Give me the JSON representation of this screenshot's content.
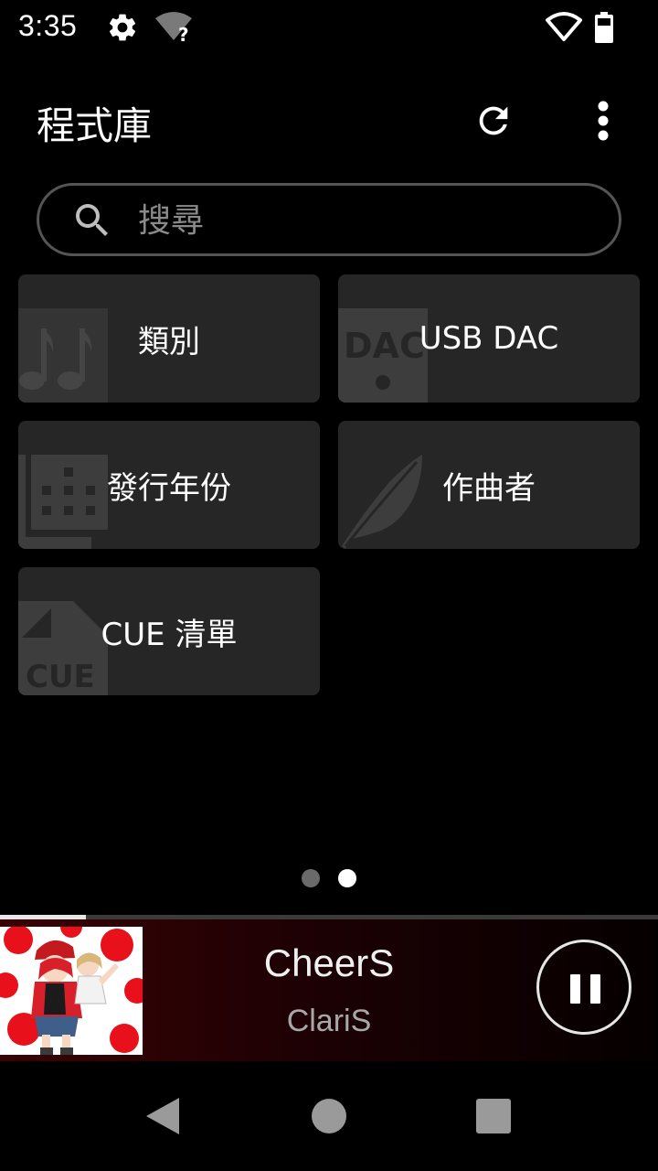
{
  "status_bar": {
    "time": "3:35",
    "icons": [
      "gear-icon",
      "wifi-no-internet-icon",
      "wifi-icon",
      "battery-icon"
    ]
  },
  "app_bar": {
    "title": "程式庫",
    "actions": [
      "refresh-icon",
      "more-vert-icon"
    ]
  },
  "search": {
    "placeholder": "搜尋"
  },
  "tiles": [
    {
      "label": "類別",
      "icon": "music-notes-icon"
    },
    {
      "label": "USB DAC",
      "icon": "dac-device-icon",
      "icon_text": "DAC"
    },
    {
      "label": "發行年份",
      "icon": "calendar-icon"
    },
    {
      "label": "作曲者",
      "icon": "quill-feather-icon"
    },
    {
      "label": "CUE 清單",
      "icon": "cue-file-icon",
      "icon_text": "CUE"
    }
  ],
  "pager": {
    "page_count": 2,
    "current_page": 2
  },
  "player": {
    "progress_fraction": 0.13,
    "title": "CheerS",
    "artist": "ClariS",
    "state": "playing",
    "control_icon": "pause-icon"
  },
  "nav_bar": {
    "icons": [
      "back-icon",
      "home-icon",
      "recents-icon"
    ]
  },
  "colors": {
    "background": "#000000",
    "tile": "#262626",
    "tile_icon": "#3d3d3d",
    "player_gradient_start": "#3a0205"
  }
}
